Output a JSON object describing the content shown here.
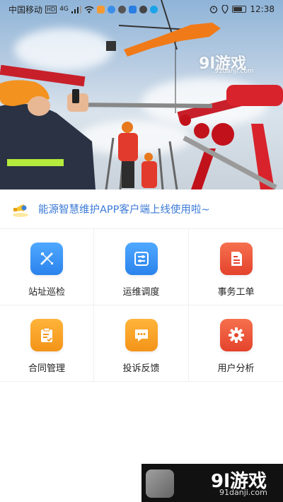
{
  "status_bar": {
    "carrier": "中国移动",
    "network": "4G",
    "time": "12:38"
  },
  "watermark_top": {
    "brand": "9l游戏",
    "url": "91danji.com"
  },
  "notice": {
    "icon": "megaphone-icon",
    "text": "能源智慧维护APP客户端上线使用啦~"
  },
  "menu": [
    {
      "label": "站址巡检",
      "icon": "tools-icon",
      "color": "#2f8ff2"
    },
    {
      "label": "运维调度",
      "icon": "sliders-icon",
      "color": "#2f8ff2"
    },
    {
      "label": "事务工单",
      "icon": "document-icon",
      "color": "#ef5a3c"
    },
    {
      "label": "合同管理",
      "icon": "clipboard-icon",
      "color": "#f5a320"
    },
    {
      "label": "投诉反馈",
      "icon": "chat-icon",
      "color": "#f5a320"
    },
    {
      "label": "用户分析",
      "icon": "gear-icon",
      "color": "#ef5a3c"
    }
  ],
  "watermark_bottom": {
    "brand": "9l游戏",
    "url": "91danji.com"
  }
}
